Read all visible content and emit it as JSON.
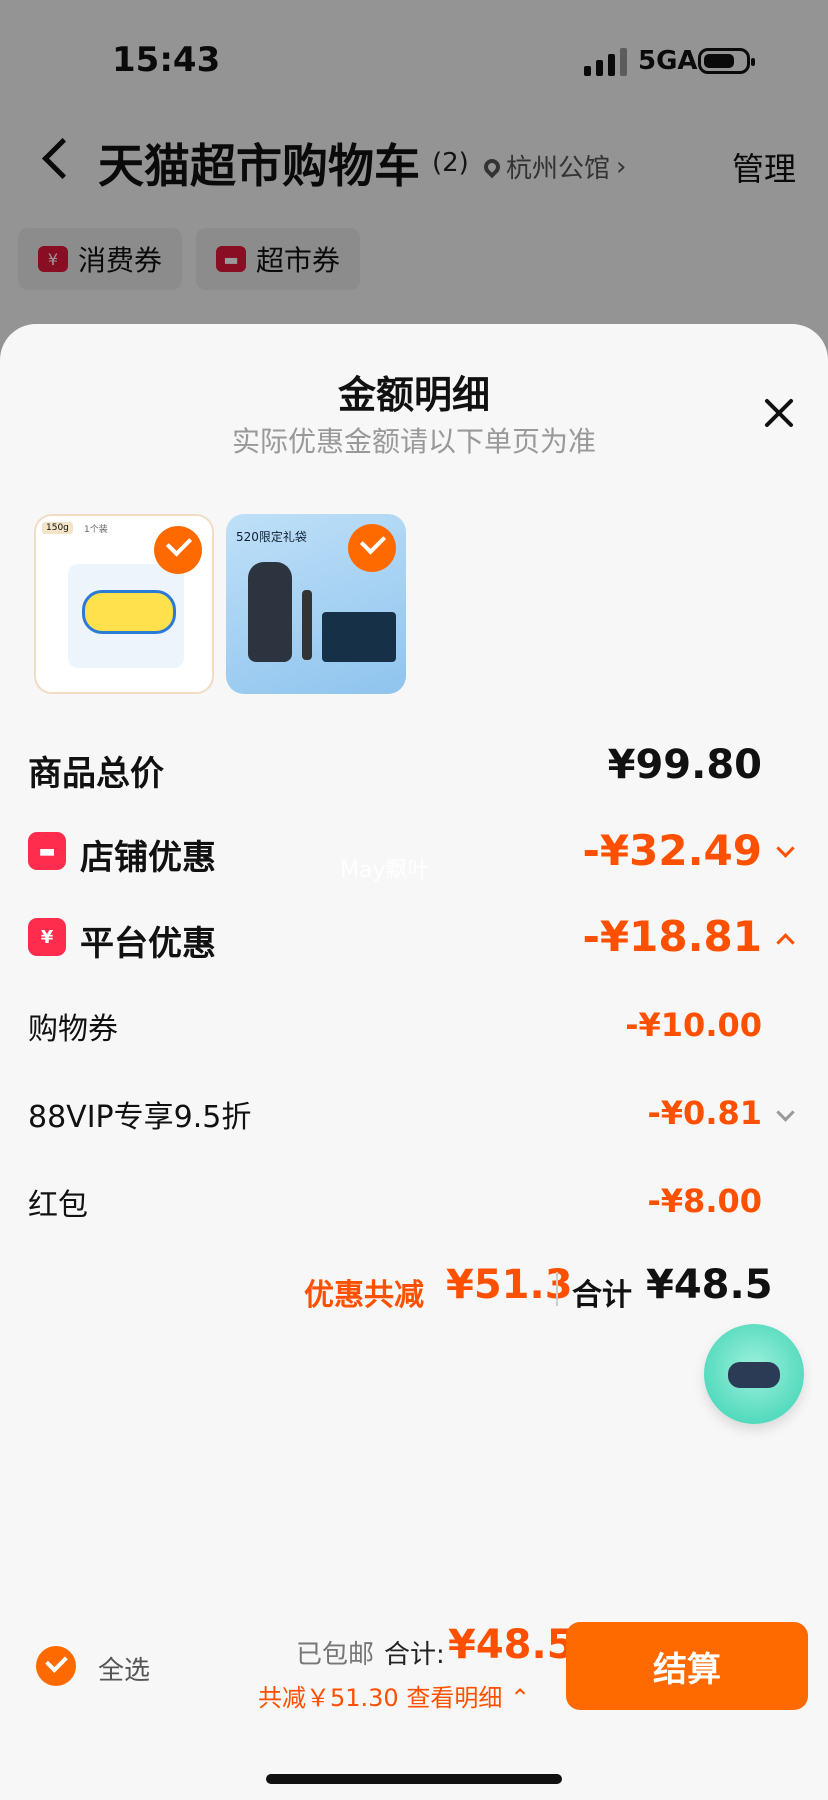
{
  "status_bar": {
    "time": "15:43",
    "network": "5GA"
  },
  "header": {
    "title": "天猫超市购物车",
    "count": "(2)",
    "location": "杭州公馆",
    "manage": "管理"
  },
  "chips": [
    {
      "label": "消费券",
      "icon": "coupon-icon"
    },
    {
      "label": "超市券",
      "icon": "store-icon"
    }
  ],
  "sheet": {
    "title": "金额明细",
    "subtitle": "实际优惠金额请以下单页为准",
    "products": [
      {
        "badge": "150g",
        "sub_badge": "1个装",
        "selected": true
      },
      {
        "badge": "520限定礼袋",
        "selected": true
      }
    ],
    "rows": {
      "total_label": "商品总价",
      "total_value": "¥99.80",
      "shop_label": "店铺优惠",
      "shop_value": "-¥32.49",
      "platform_label": "平台优惠",
      "platform_value": "-¥18.81",
      "coupon_label": "购物券",
      "coupon_value": "-¥10.00",
      "vip_label": "88VIP专享9.5折",
      "vip_value": "-¥0.81",
      "redpacket_label": "红包",
      "redpacket_value": "-¥8.00"
    },
    "summary": {
      "discount_label": "优惠共减",
      "discount_value": "¥51.3",
      "total_label": "合计",
      "total_value": "¥48.5"
    },
    "watermark": "May飘叶"
  },
  "bottom_bar": {
    "select_all": "全选",
    "shipping": "已包邮",
    "total_label": "合计:",
    "total_value": "¥48.5",
    "savings": "共减￥51.30 查看明细",
    "pay_button": "结算"
  },
  "colors": {
    "accent": "#ff5000",
    "button": "#ff6a00",
    "badge_red": "#ff2d4d"
  }
}
